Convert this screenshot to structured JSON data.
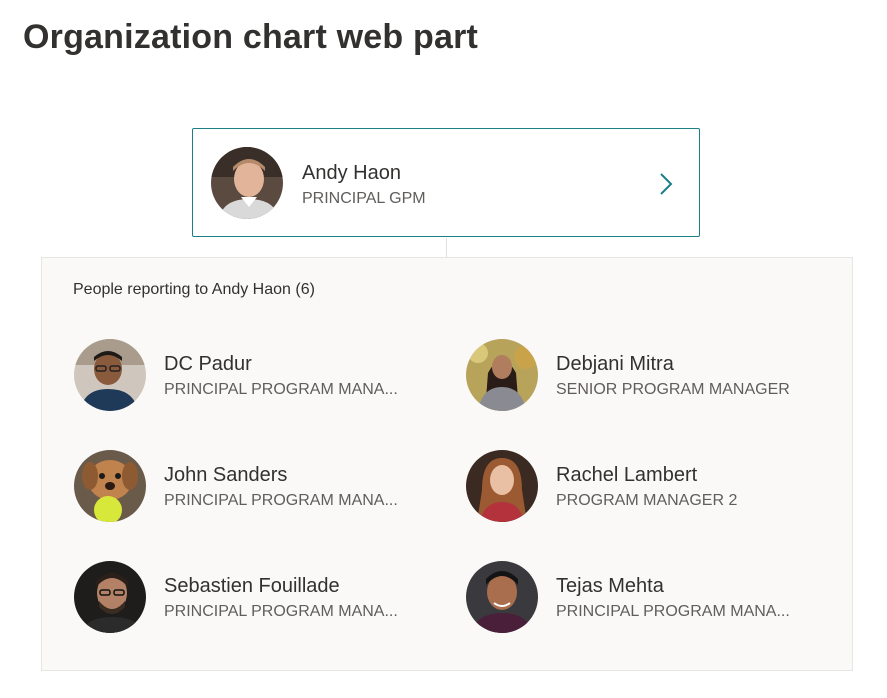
{
  "page": {
    "title": "Organization chart web part"
  },
  "manager": {
    "name": "Andy Haon",
    "title": "PRINCIPAL GPM",
    "avatar_icon": "person-avatar",
    "chevron_icon": "chevron-right-icon",
    "accent_color": "#1b7f86"
  },
  "reports": {
    "heading": "People reporting to Andy Haon (6)",
    "people": [
      {
        "name": "DC Padur",
        "title": "PRINCIPAL PROGRAM MANA..."
      },
      {
        "name": "Debjani Mitra",
        "title": "SENIOR PROGRAM MANAGER"
      },
      {
        "name": "John Sanders",
        "title": "PRINCIPAL PROGRAM MANA..."
      },
      {
        "name": "Rachel Lambert",
        "title": "PROGRAM MANAGER 2"
      },
      {
        "name": "Sebastien Fouillade",
        "title": "PRINCIPAL PROGRAM MANA..."
      },
      {
        "name": "Tejas Mehta",
        "title": "PRINCIPAL PROGRAM MANA..."
      }
    ]
  }
}
